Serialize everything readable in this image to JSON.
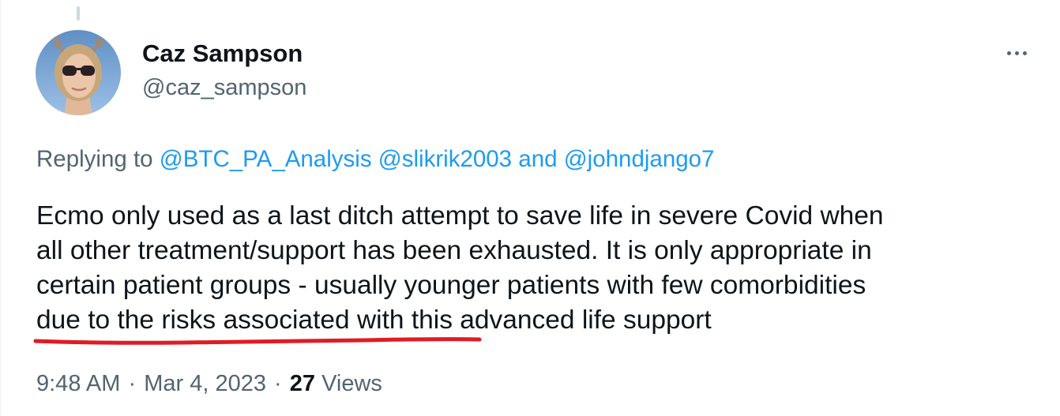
{
  "author": {
    "display_name": "Caz Sampson",
    "handle": "@caz_sampson"
  },
  "more_icon": "more-horizontal-icon",
  "reply_context": {
    "prefix": "Replying to",
    "mention_1": "@BTC_PA_Analysis",
    "mention_2": "@slikrik2003",
    "conjunction": "and",
    "mention_3": "@johndjango7"
  },
  "tweet": {
    "line_1": "Ecmo only used as a last ditch attempt to save life in severe Covid when",
    "line_2": "all other treatment/support has been exhausted. It is only appropriate in",
    "line_3": "certain patient groups - usually younger patients with few comorbidities",
    "line_4": "due to the risks associated with this advanced life support"
  },
  "annotation": {
    "underline_color": "#e01b24"
  },
  "meta": {
    "time": "9:48 AM",
    "separator": "·",
    "date": "Mar 4, 2023",
    "views_count": "27",
    "views_label": "Views"
  },
  "colors": {
    "link": "#1d9bf0",
    "secondary_text": "#536471",
    "primary_text": "#0f1419"
  }
}
